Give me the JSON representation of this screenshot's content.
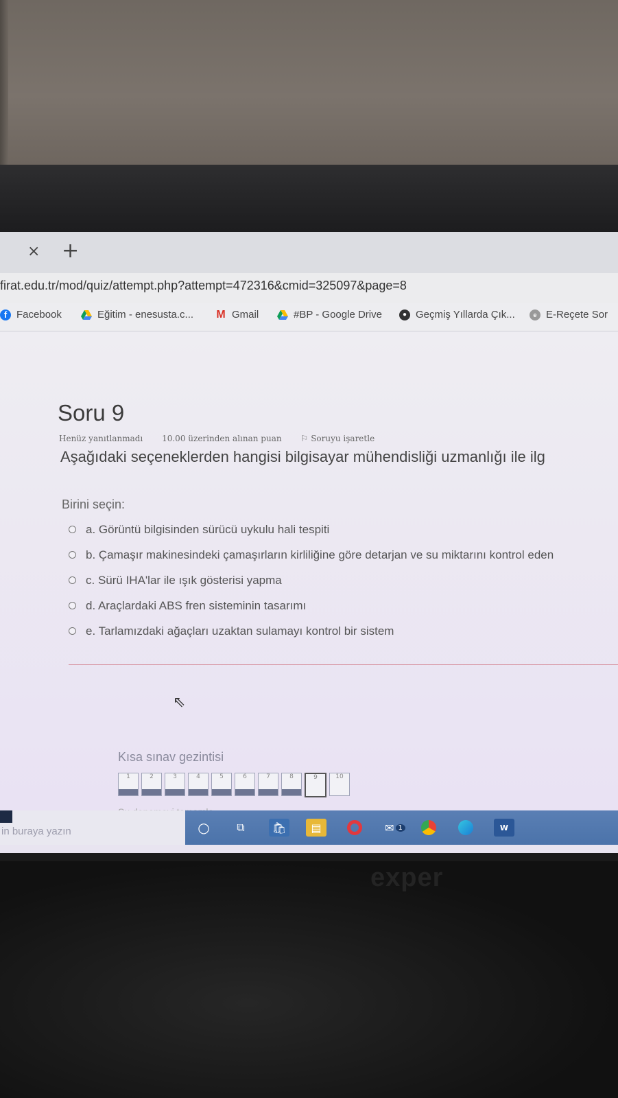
{
  "browser": {
    "tab_close_label": "×",
    "tab_new_label": "+",
    "url": "firat.edu.tr/mod/quiz/attempt.php?attempt=472316&cmid=325097&page=8",
    "bookmarks": [
      {
        "label": "Facebook",
        "icon": "facebook-icon"
      },
      {
        "label": "Eğitim - enesusta.c...",
        "icon": "google-drive-icon"
      },
      {
        "label": "Gmail",
        "icon": "gmail-icon"
      },
      {
        "label": "#BP - Google Drive",
        "icon": "google-drive-icon"
      },
      {
        "label": "Geçmiş Yıllarda Çık...",
        "icon": "globe-icon"
      },
      {
        "label": "E-Reçete Sor",
        "icon": "site-icon"
      }
    ]
  },
  "question": {
    "title": "Soru 9",
    "status": "Henüz yanıtlanmadı",
    "points": "10.00 üzerinden alınan puan",
    "flag_label": "Soruyu işaretle",
    "text": "Aşağıdaki seçeneklerden hangisi bilgisayar mühendisliği uzmanlığı ile ilg",
    "choose_label": "Birini seçin:",
    "options": [
      "a. Görüntü bilgisinden sürücü uykulu hali tespiti",
      "b. Çamaşır makinesindeki çamaşırların kirliliğine göre detarjan ve su miktarını kontrol eden",
      "c. Sürü IHA'lar ile ışık gösterisi yapma",
      "d. Araçlardaki ABS fren sisteminin tasarımı",
      "e. Tarlamızdaki ağaçları uzaktan sulamayı kontrol bir sistem"
    ]
  },
  "quiz_nav": {
    "title": "Kısa sınav gezintisi",
    "pages": [
      "1",
      "2",
      "3",
      "4",
      "5",
      "6",
      "7",
      "8",
      "9",
      "10"
    ],
    "answered_count": 8,
    "current_page": "9",
    "finish_label": "Şu denemeyi tamamla..."
  },
  "taskbar": {
    "search_placeholder": "in buraya yazın",
    "icons": [
      "cortana-icon",
      "task-view-icon",
      "store-icon",
      "file-explorer-icon",
      "opera-icon",
      "mail-icon",
      "chrome-icon",
      "edge-icon",
      "word-icon"
    ],
    "mail_badge": "1"
  },
  "device": {
    "brand": "exper"
  }
}
